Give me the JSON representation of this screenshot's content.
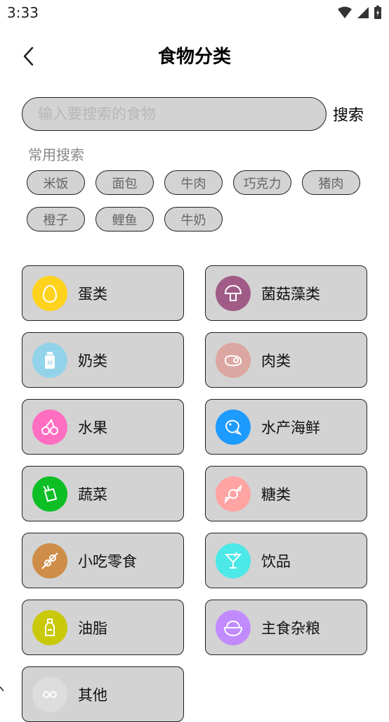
{
  "status_bar": {
    "time": "3:33"
  },
  "header": {
    "title": "食物分类"
  },
  "search": {
    "placeholder": "输入要搜索的食物",
    "button_label": "搜索"
  },
  "common": {
    "title": "常用搜索",
    "chips": [
      "米饭",
      "面包",
      "牛肉",
      "巧克力",
      "猪肉",
      "橙子",
      "鲤鱼",
      "牛奶"
    ]
  },
  "categories": [
    {
      "label": "蛋类",
      "icon": "egg-icon",
      "color": "#FFD21E"
    },
    {
      "label": "菌菇藻类",
      "icon": "mushroom-icon",
      "color": "#A05C86"
    },
    {
      "label": "奶类",
      "icon": "milk-bottle-icon",
      "color": "#93D3EA"
    },
    {
      "label": "肉类",
      "icon": "steak-icon",
      "color": "#DCA7A0"
    },
    {
      "label": "水果",
      "icon": "cherry-icon",
      "color": "#FF6EC1"
    },
    {
      "label": "水产海鲜",
      "icon": "fish-icon",
      "color": "#1E9BFF"
    },
    {
      "label": "蔬菜",
      "icon": "vegetable-icon",
      "color": "#0DBF24"
    },
    {
      "label": "糖类",
      "icon": "candy-icon",
      "color": "#FFA3A3"
    },
    {
      "label": "小吃零食",
      "icon": "skewer-icon",
      "color": "#CE8D48"
    },
    {
      "label": "饮品",
      "icon": "cocktail-icon",
      "color": "#4DE8E8"
    },
    {
      "label": "油脂",
      "icon": "oil-bottle-icon",
      "color": "#C9C90A"
    },
    {
      "label": "主食杂粮",
      "icon": "rice-bowl-icon",
      "color": "#C18BFF"
    },
    {
      "label": "其他",
      "icon": "other-icon",
      "color": "#DDDDDD"
    }
  ]
}
